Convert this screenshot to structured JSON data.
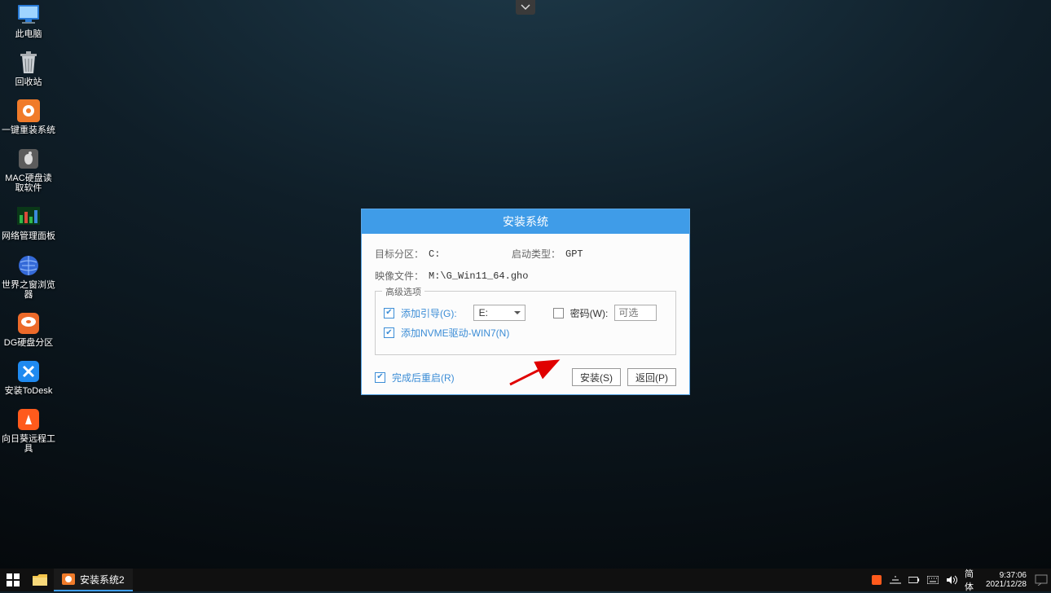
{
  "top_chevron": {
    "name": "expand-bar"
  },
  "desktop": {
    "items": [
      {
        "name": "this-pc",
        "label": "此电脑",
        "color": "#2a7bd6"
      },
      {
        "name": "recycle-bin",
        "label": "回收站",
        "color": "#9da3a6"
      },
      {
        "name": "onekey-install",
        "label": "一键重装系统",
        "color": "#f07b2a"
      },
      {
        "name": "mac-disk-read",
        "label": "MAC硬盘读\n取软件",
        "color": "#5c5c5c"
      },
      {
        "name": "network-monitor",
        "label": "网络管理面板",
        "color": "#1d5f2a"
      },
      {
        "name": "world-browser",
        "label": "世界之窗浏览\n器",
        "color": "#356ad8"
      },
      {
        "name": "dg-partition",
        "label": "DG硬盘分区",
        "color": "#ec6a2a"
      },
      {
        "name": "install-todesk",
        "label": "安装ToDesk",
        "color": "#1f8af0"
      },
      {
        "name": "sunlogin-remote",
        "label": "向日葵远程工\n具",
        "color": "#ff5a1c"
      }
    ]
  },
  "dialog": {
    "title": "安装系统",
    "target_label": "目标分区：",
    "target_value": "C:",
    "boot_label": "启动类型：",
    "boot_value": "GPT",
    "image_label": "映像文件：",
    "image_value": "M:\\G_Win11_64.gho",
    "advanced_label": "高级选项",
    "add_boot_label": "添加引导(G):",
    "add_boot_checked": true,
    "boot_select": "E:",
    "password_label": "密码(W):",
    "password_checked": false,
    "password_placeholder": "可选",
    "nvme_label": "添加NVME驱动-WIN7(N)",
    "nvme_checked": true,
    "reboot_label": "完成后重启(R)",
    "reboot_checked": true,
    "install_btn": "安装(S)",
    "back_btn": "返回(P)"
  },
  "taskbar": {
    "apps": [
      {
        "name": "install-system-window",
        "title": "安装系统2"
      }
    ],
    "tray": {
      "ime": "简体"
    },
    "clock": {
      "time": "9:37:06",
      "date": "2021/12/28"
    }
  },
  "colors": {
    "accent": "#3f9ce8",
    "link": "#3c8dd6"
  }
}
